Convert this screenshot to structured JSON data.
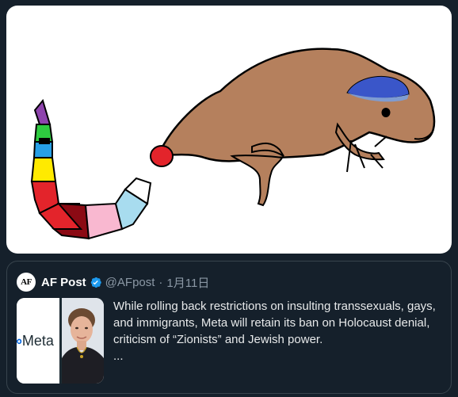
{
  "quoted_tweet": {
    "avatar_text": "AF",
    "display_name": "AF Post",
    "verified": true,
    "handle": "@AFpost",
    "separator": "·",
    "date": "1月11日",
    "body_text": "While rolling back restrictions on insulting transsexuals, gays, and immigrants, Meta will retain its ban on Holocaust denial, criticism of “Zionists” and Jewish power.",
    "more": "...",
    "thumbnail_brand_text": "Meta",
    "thumbnail_brand_mark": "∞"
  },
  "colors": {
    "background": "#15202b",
    "border": "#38444d",
    "verified": "#1d9bf0",
    "secondary_text": "#8b98a5",
    "primary_text": "#e7e9ea"
  }
}
